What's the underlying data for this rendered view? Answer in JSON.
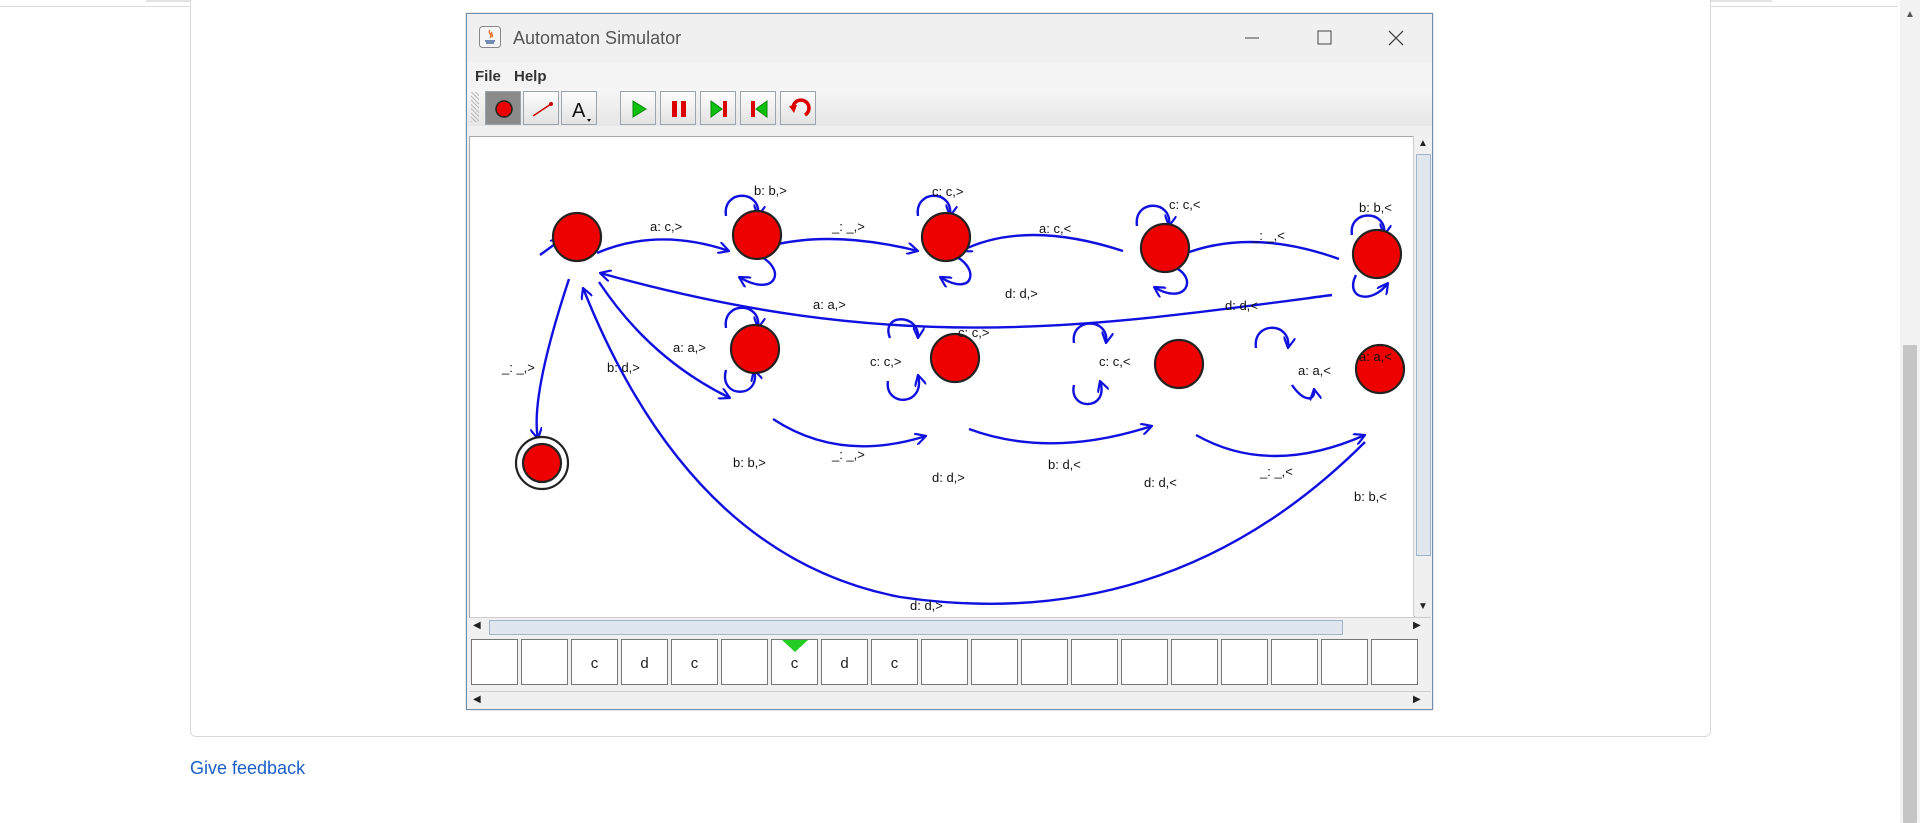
{
  "window": {
    "title": "Automaton Simulator"
  },
  "menu": {
    "file": "File",
    "help": "Help"
  },
  "toolbar": {
    "tools": [
      "state-tool",
      "transition-tool",
      "text-tool",
      "run",
      "pause",
      "step",
      "reset",
      "undo"
    ]
  },
  "edge_labels": {
    "q0_q1": "a: c,>",
    "q1_loop": "b: b,>",
    "q1_q2": "_: _,>",
    "q1_q0": "a: a,>",
    "q2_loop": "c: c,>",
    "q2_d": "d: d,>",
    "q2_q3": "a: c,<",
    "q3_loop": "c: c,<",
    "q3_q4": "_: _,<",
    "q3_d": "d: d,<",
    "q4_loop": "b: b,<",
    "q4_q0": "c: c,>",
    "q4_a": "a: a,<",
    "q0_acc": "_: _,>",
    "q0_q5": "b: d,>",
    "q5_loop_a": "a: a,>",
    "q5_loop_b": "b: b,>",
    "q5_q6": "_: _,>",
    "q6_loop_c": "c: c,>",
    "q6_loop_d": "d: d,>",
    "q6_q7": "b: d,<",
    "q7_loop_c": "c: c,<",
    "q7_loop_d": "d: d,<",
    "q7_q8": "_: _,<",
    "q8_loop_a": "a: a,<",
    "q8_loop_b": "b: b,<",
    "q8_q0": "d: d,>"
  },
  "tape": {
    "cells": [
      "",
      "",
      "c",
      "d",
      "c",
      "",
      "c",
      "d",
      "c",
      "",
      "",
      "",
      "",
      "",
      "",
      "",
      "",
      "",
      ""
    ],
    "head_index": 6
  },
  "page": {
    "feedback_link": "Give feedback"
  },
  "colors": {
    "state_fill": "#ee0000",
    "edge": "#1010e0",
    "tape_head": "#22cc22"
  }
}
